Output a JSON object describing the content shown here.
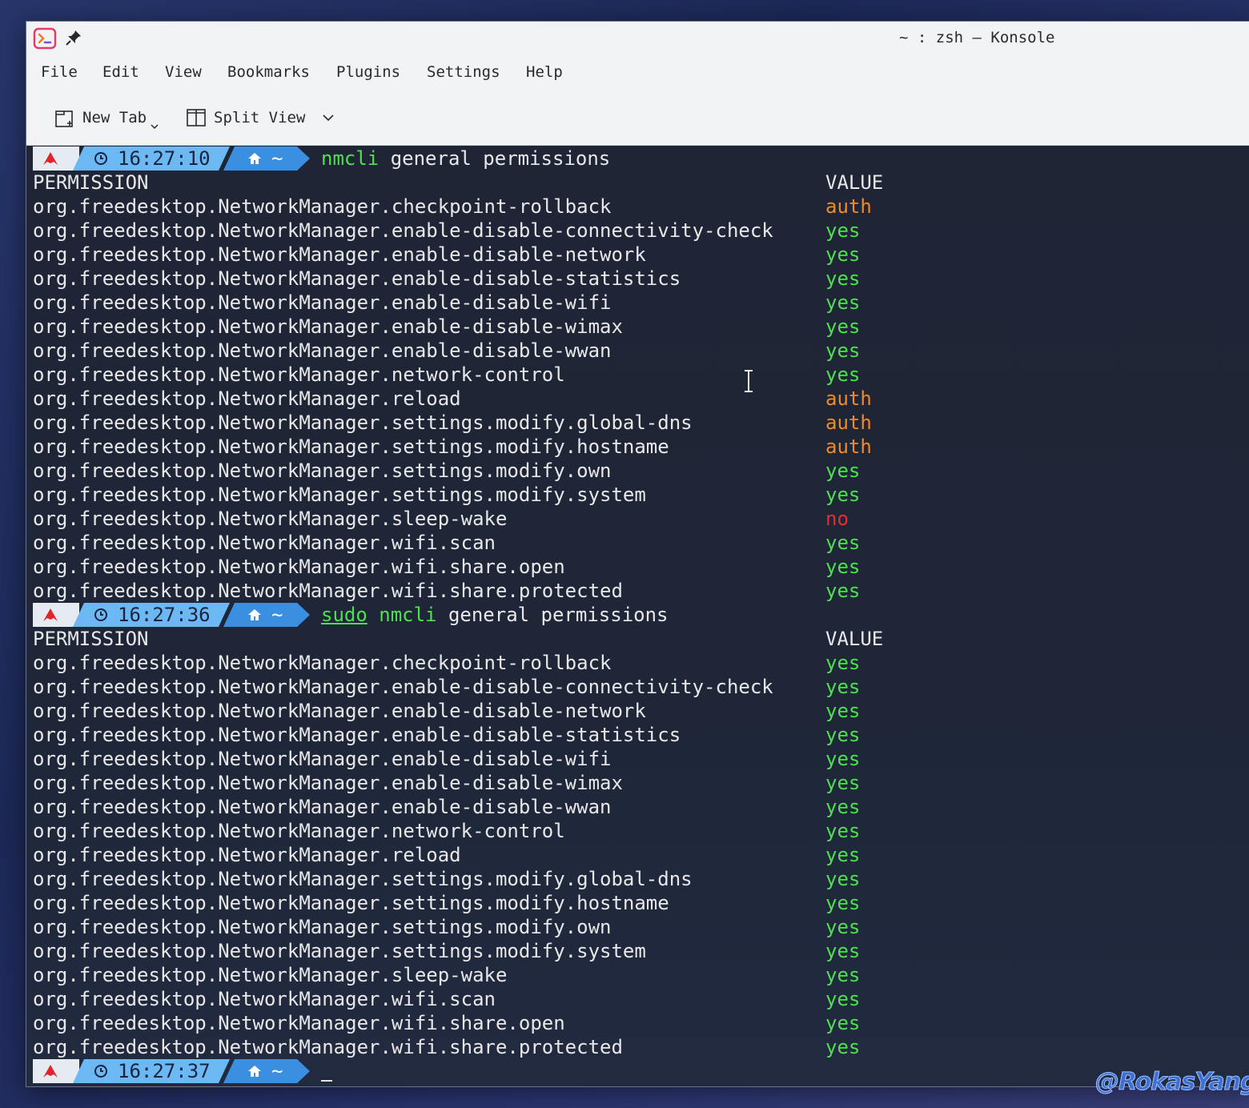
{
  "window": {
    "title": "~ : zsh — Konsole"
  },
  "menu": [
    "File",
    "Edit",
    "View",
    "Bookmarks",
    "Plugins",
    "Settings",
    "Help"
  ],
  "toolbar": {
    "new_tab": "New Tab",
    "split_view": "Split View"
  },
  "prompts": [
    {
      "time": "16:27:10",
      "dir": "~",
      "cmd_prefix": "",
      "cmd_bin": "nmcli",
      "cmd_args": " general permissions"
    },
    {
      "time": "16:27:36",
      "dir": "~",
      "cmd_prefix": "sudo",
      "cmd_bin": " nmcli",
      "cmd_args": " general permissions"
    },
    {
      "time": "16:27:37",
      "dir": "~",
      "cmd_prefix": "",
      "cmd_bin": "",
      "cmd_args": ""
    }
  ],
  "headers": {
    "permission": "PERMISSION",
    "value": "VALUE"
  },
  "outputs": [
    [
      [
        "org.freedesktop.NetworkManager.checkpoint-rollback",
        "auth"
      ],
      [
        "org.freedesktop.NetworkManager.enable-disable-connectivity-check",
        "yes"
      ],
      [
        "org.freedesktop.NetworkManager.enable-disable-network",
        "yes"
      ],
      [
        "org.freedesktop.NetworkManager.enable-disable-statistics",
        "yes"
      ],
      [
        "org.freedesktop.NetworkManager.enable-disable-wifi",
        "yes"
      ],
      [
        "org.freedesktop.NetworkManager.enable-disable-wimax",
        "yes"
      ],
      [
        "org.freedesktop.NetworkManager.enable-disable-wwan",
        "yes"
      ],
      [
        "org.freedesktop.NetworkManager.network-control",
        "yes"
      ],
      [
        "org.freedesktop.NetworkManager.reload",
        "auth"
      ],
      [
        "org.freedesktop.NetworkManager.settings.modify.global-dns",
        "auth"
      ],
      [
        "org.freedesktop.NetworkManager.settings.modify.hostname",
        "auth"
      ],
      [
        "org.freedesktop.NetworkManager.settings.modify.own",
        "yes"
      ],
      [
        "org.freedesktop.NetworkManager.settings.modify.system",
        "yes"
      ],
      [
        "org.freedesktop.NetworkManager.sleep-wake",
        "no"
      ],
      [
        "org.freedesktop.NetworkManager.wifi.scan",
        "yes"
      ],
      [
        "org.freedesktop.NetworkManager.wifi.share.open",
        "yes"
      ],
      [
        "org.freedesktop.NetworkManager.wifi.share.protected",
        "yes"
      ]
    ],
    [
      [
        "org.freedesktop.NetworkManager.checkpoint-rollback",
        "yes"
      ],
      [
        "org.freedesktop.NetworkManager.enable-disable-connectivity-check",
        "yes"
      ],
      [
        "org.freedesktop.NetworkManager.enable-disable-network",
        "yes"
      ],
      [
        "org.freedesktop.NetworkManager.enable-disable-statistics",
        "yes"
      ],
      [
        "org.freedesktop.NetworkManager.enable-disable-wifi",
        "yes"
      ],
      [
        "org.freedesktop.NetworkManager.enable-disable-wimax",
        "yes"
      ],
      [
        "org.freedesktop.NetworkManager.enable-disable-wwan",
        "yes"
      ],
      [
        "org.freedesktop.NetworkManager.network-control",
        "yes"
      ],
      [
        "org.freedesktop.NetworkManager.reload",
        "yes"
      ],
      [
        "org.freedesktop.NetworkManager.settings.modify.global-dns",
        "yes"
      ],
      [
        "org.freedesktop.NetworkManager.settings.modify.hostname",
        "yes"
      ],
      [
        "org.freedesktop.NetworkManager.settings.modify.own",
        "yes"
      ],
      [
        "org.freedesktop.NetworkManager.settings.modify.system",
        "yes"
      ],
      [
        "org.freedesktop.NetworkManager.sleep-wake",
        "yes"
      ],
      [
        "org.freedesktop.NetworkManager.wifi.scan",
        "yes"
      ],
      [
        "org.freedesktop.NetworkManager.wifi.share.open",
        "yes"
      ],
      [
        "org.freedesktop.NetworkManager.wifi.share.protected",
        "yes"
      ]
    ]
  ],
  "watermark": "@RokasYang"
}
